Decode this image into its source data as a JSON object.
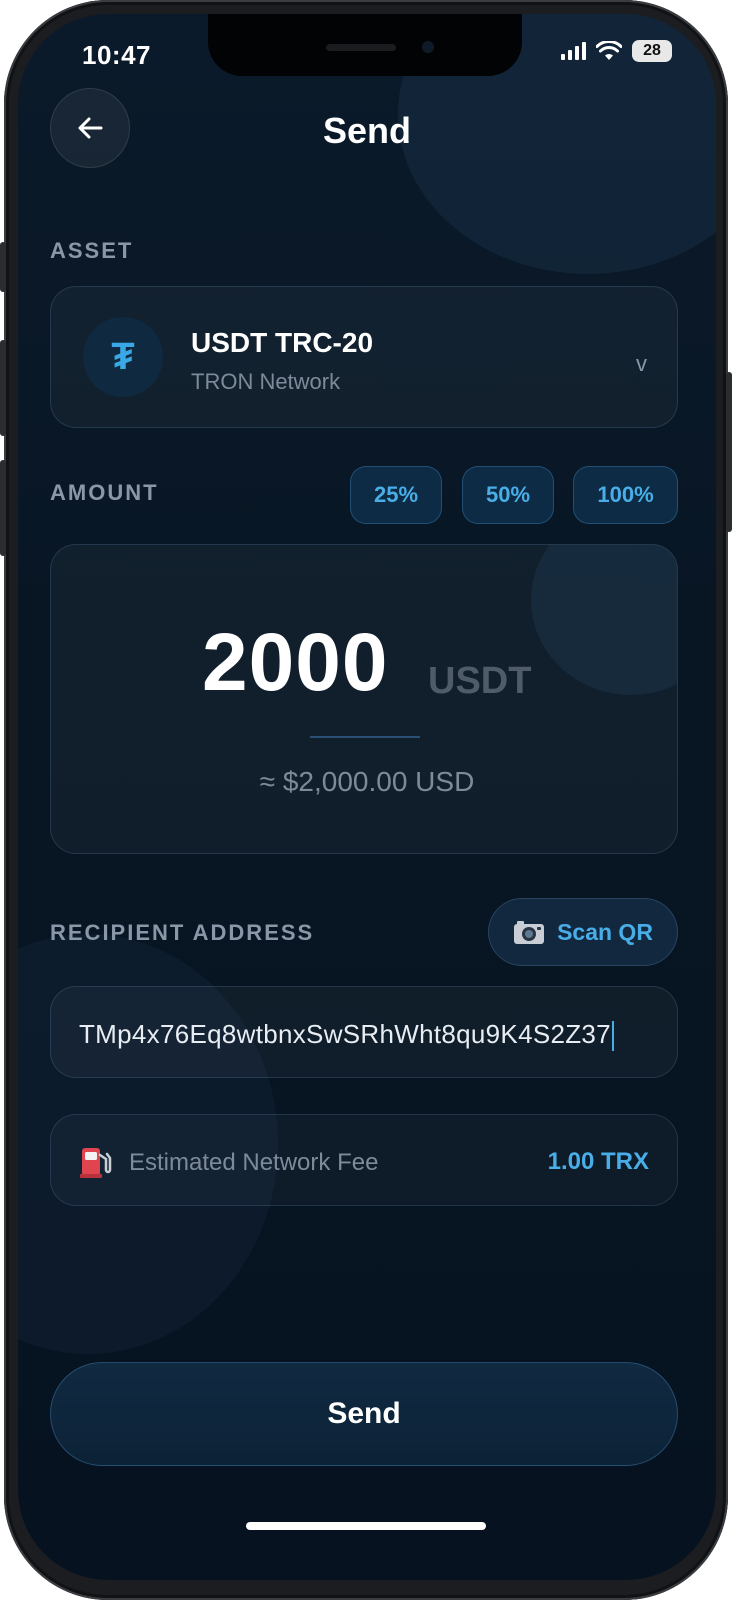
{
  "status_bar": {
    "time": "10:47",
    "battery": "28"
  },
  "header": {
    "title": "Send"
  },
  "asset": {
    "section_label": "ASSET",
    "icon_glyph": "₮",
    "name": "USDT TRC-20",
    "network": "TRON Network",
    "chevron": "v"
  },
  "amount": {
    "section_label": "AMOUNT",
    "quick_buttons": [
      "25%",
      "50%",
      "100%"
    ],
    "value": "2000",
    "unit": "USDT",
    "fiat_equivalent": "≈ $2,000.00 USD"
  },
  "recipient": {
    "section_label": "RECIPIENT ADDRESS",
    "scan_label": "Scan QR",
    "address": "TMp4x76Eq8wtbnxSwSRhWht8qu9K4S2Z37"
  },
  "fee": {
    "label": "Estimated Network Fee",
    "value": "1.00 TRX"
  },
  "send_button": {
    "label": "Send"
  },
  "colors": {
    "accent": "#49aee8",
    "background": "#081624"
  }
}
